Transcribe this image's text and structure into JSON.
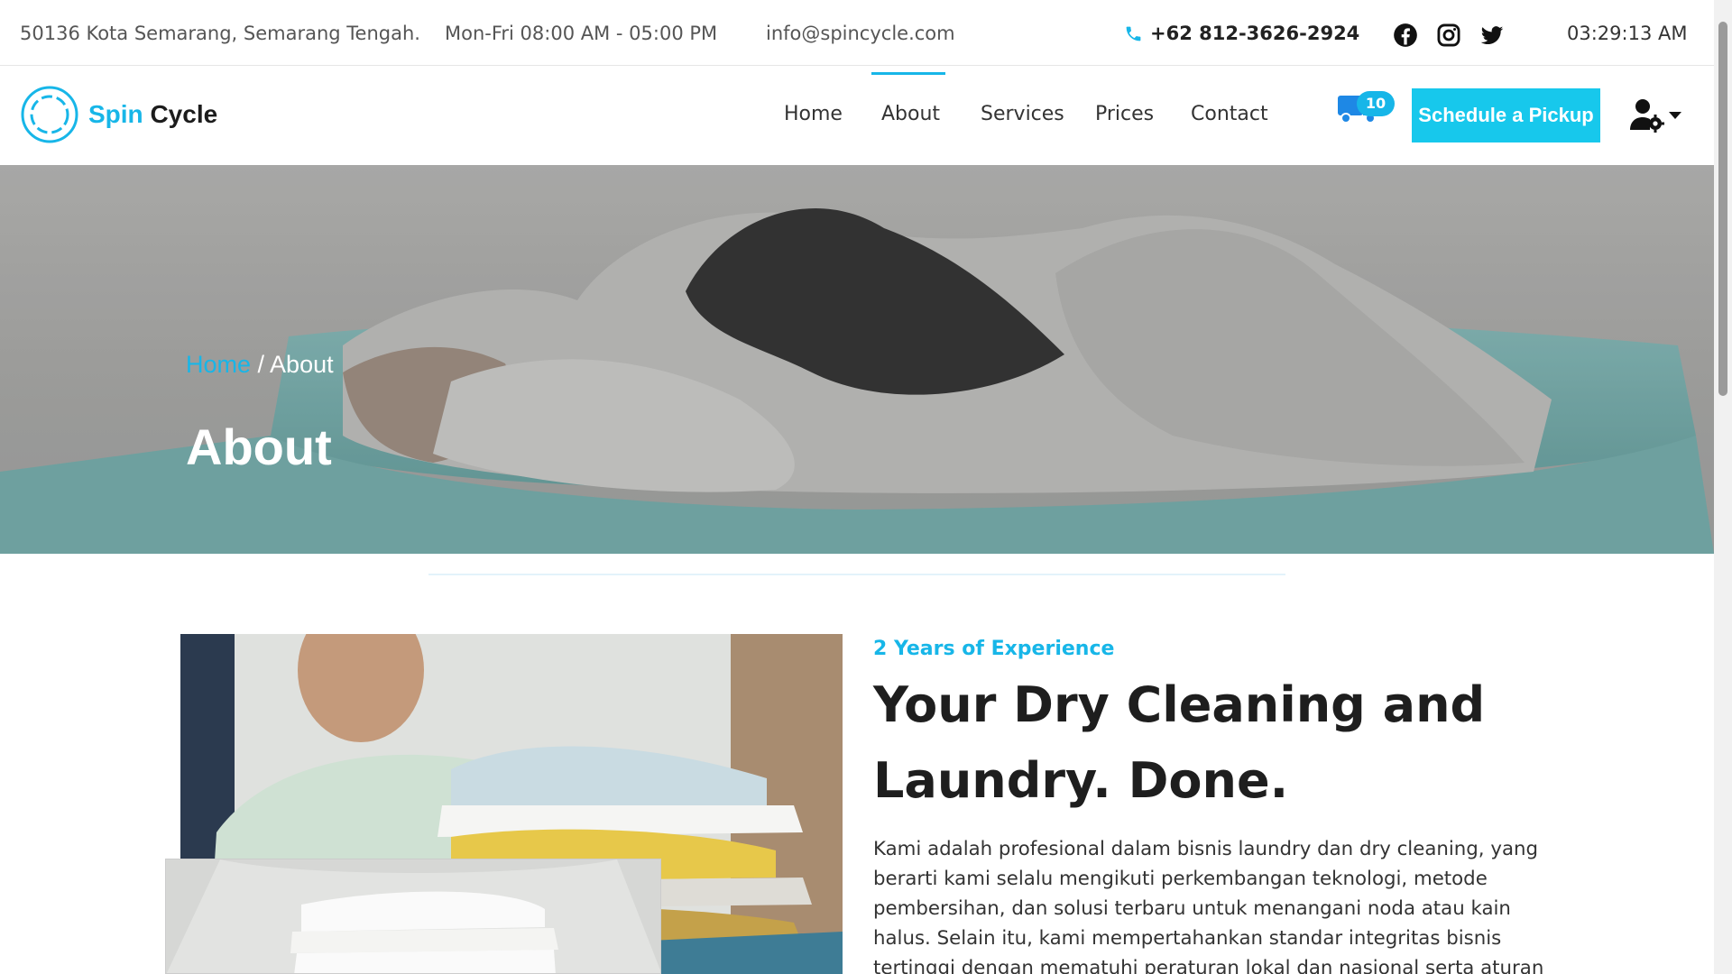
{
  "topbar": {
    "address": "50136 Kota Semarang, Semarang Tengah.",
    "hours": "Mon-Fri 08:00 AM - 05:00 PM",
    "email": "info@spincycle.com",
    "phone": "+62 812-3626-2924",
    "social_icons": [
      "facebook-icon",
      "instagram-icon",
      "twitter-icon"
    ],
    "clock": "03:29:13 AM"
  },
  "brand": {
    "spin": "Spin",
    "cycle": "Cycle"
  },
  "nav": {
    "items": [
      {
        "label": "Home",
        "active": false
      },
      {
        "label": "About",
        "active": true
      },
      {
        "label": "Services",
        "active": false
      },
      {
        "label": "Prices",
        "active": false
      },
      {
        "label": "Contact",
        "active": false
      }
    ],
    "cart_count": "10",
    "cta_label": "Schedule a Pickup"
  },
  "hero": {
    "breadcrumb_home": "Home",
    "breadcrumb_sep": " / ",
    "breadcrumb_current": "About",
    "title": "About"
  },
  "about": {
    "experience": "2 Years of Experience",
    "title": "Your Dry Cleaning and Laundry. Done.",
    "paragraph": "Kami adalah profesional dalam bisnis laundry dan dry cleaning, yang berarti kami selalu mengikuti perkembangan teknologi, metode pembersihan, dan solusi terbaru untuk menangani noda atau kain halus. Selain itu, kami mempertahankan standar integritas bisnis tertinggi dengan mematuhi peraturan lokal dan nasional serta aturan keselamatan lingkungan. Kami"
  },
  "colors": {
    "accent": "#17b6e8",
    "cta": "#17c8ec",
    "text_dark": "#1e1e1e"
  }
}
